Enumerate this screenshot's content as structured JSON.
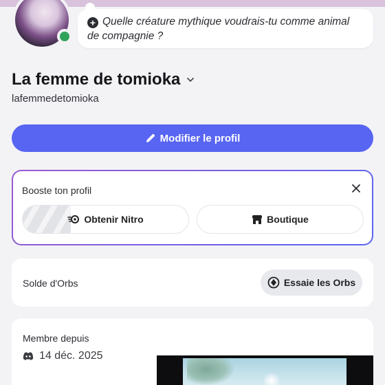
{
  "status_bubble": {
    "text": "Quelle créature mythique voudrais-tu comme animal de compagnie ?"
  },
  "profile": {
    "display_name": "La femme de tomioka",
    "username": "lafemmedetomioka",
    "status": "online"
  },
  "actions": {
    "edit_profile_label": "Modifier le profil"
  },
  "boost": {
    "title": "Booste ton profil",
    "nitro_label": "Obtenir Nitro",
    "shop_label": "Boutique"
  },
  "orbs": {
    "label": "Solde d'Orbs",
    "button_label": "Essaie les Orbs"
  },
  "member": {
    "label": "Membre depuis",
    "date": "14 déc. 2025"
  },
  "colors": {
    "accent": "#5865f2",
    "online": "#2fa35a",
    "gradient_start": "#9b59d0"
  }
}
